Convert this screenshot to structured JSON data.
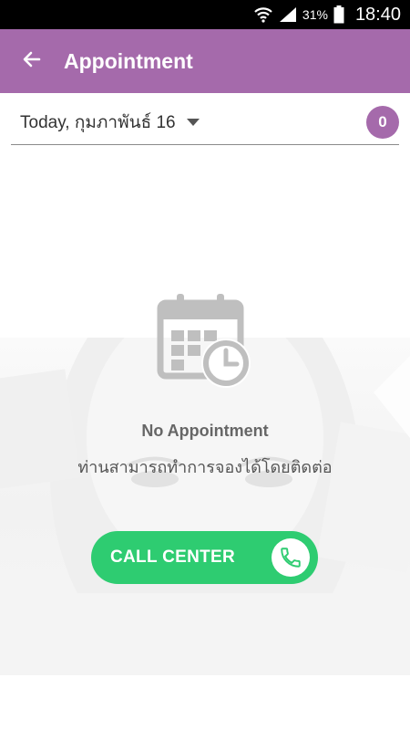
{
  "status_bar": {
    "icons": [
      "wifi-icon",
      "signal-icon",
      "battery-icon"
    ],
    "battery_percent": "31%",
    "time": "18:40"
  },
  "app_bar": {
    "back_icon": "arrow-left-icon",
    "title": "Appointment",
    "color": "#a56aab"
  },
  "date_filter": {
    "label": "Today, กุมภาพันธ์ 16",
    "dropdown_icon": "chevron-down-icon",
    "count": "0"
  },
  "empty_state": {
    "icon": "calendar-clock-icon",
    "title": "No Appointment",
    "subtitle": "ท่านสามารถทำการจองได้โดยติดต่อ"
  },
  "call_center": {
    "label": "CALL CENTER",
    "icon": "phone-icon",
    "color": "#2ecc71"
  }
}
